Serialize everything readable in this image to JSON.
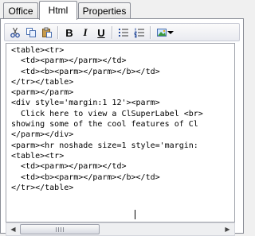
{
  "tabs": [
    {
      "label": "Office",
      "active": false
    },
    {
      "label": "Html",
      "active": true
    },
    {
      "label": "Properties",
      "active": false
    }
  ],
  "toolbar": {
    "items": [
      {
        "name": "cut-icon"
      },
      {
        "name": "copy-icon"
      },
      {
        "name": "paste-icon"
      },
      {
        "name": "bold-button",
        "label": "B"
      },
      {
        "name": "italic-button",
        "label": "I"
      },
      {
        "name": "underline-button",
        "label": "U"
      },
      {
        "name": "bullet-list-icon"
      },
      {
        "name": "numbered-list-icon"
      },
      {
        "name": "insert-image-icon"
      },
      {
        "name": "dropdown-arrow-icon"
      }
    ]
  },
  "editor": {
    "lines": [
      "<table><tr>",
      "  <td><parm></parm></td>",
      "  <td><b><parm></parm></b></td>",
      "</tr></table>",
      "<parm></parm>",
      "<div style='margin:1 12'><parm>",
      "  Click here to view a ClSuperLabel <br>",
      "showing some of the cool features of Cl",
      "</parm></div>",
      "<parm><hr noshade size=1 style='margin:",
      "<table><tr>",
      "  <td><parm></parm></td>",
      "  <td><b><parm></parm></b></td>",
      "</tr></table>"
    ]
  }
}
